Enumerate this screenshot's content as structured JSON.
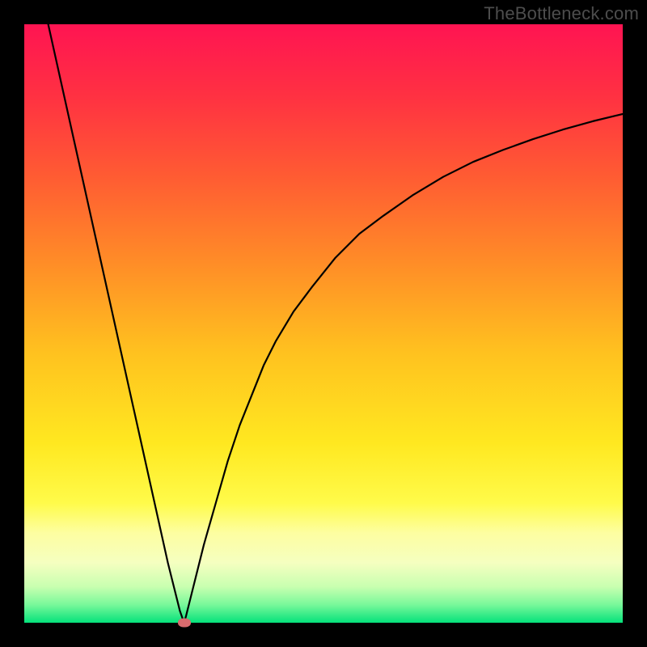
{
  "watermark": "TheBottleneck.com",
  "chart_data": {
    "type": "line",
    "title": "",
    "xlabel": "",
    "ylabel": "",
    "xlim": [
      0,
      100
    ],
    "ylim": [
      0,
      100
    ],
    "grid": false,
    "series": [
      {
        "name": "curve",
        "x": [
          4,
          6,
          8,
          10,
          12,
          14,
          16,
          18,
          20,
          22,
          24,
          26,
          26.7,
          27,
          28,
          30,
          32,
          34,
          36,
          38,
          40,
          42,
          45,
          48,
          52,
          56,
          60,
          65,
          70,
          75,
          80,
          85,
          90,
          95,
          100
        ],
        "y": [
          100,
          91,
          82,
          73,
          64,
          55,
          46,
          37,
          28,
          19,
          10,
          2,
          0,
          1,
          5,
          13,
          20,
          27,
          33,
          38,
          43,
          47,
          52,
          56,
          61,
          65,
          68,
          71.5,
          74.5,
          77,
          79,
          80.8,
          82.4,
          83.8,
          85
        ]
      }
    ],
    "marker": {
      "x": 26.7,
      "y": 0
    },
    "gradient_stops": [
      {
        "pct": 0,
        "color": "#ff1452"
      },
      {
        "pct": 12,
        "color": "#ff3142"
      },
      {
        "pct": 25,
        "color": "#ff5a33"
      },
      {
        "pct": 40,
        "color": "#ff8d27"
      },
      {
        "pct": 55,
        "color": "#ffc21f"
      },
      {
        "pct": 70,
        "color": "#ffe820"
      },
      {
        "pct": 80,
        "color": "#fffb4a"
      },
      {
        "pct": 85,
        "color": "#fdfea1"
      },
      {
        "pct": 90,
        "color": "#f5ffc0"
      },
      {
        "pct": 94,
        "color": "#c8ffb0"
      },
      {
        "pct": 97,
        "color": "#78f89a"
      },
      {
        "pct": 100,
        "color": "#05e27b"
      }
    ]
  }
}
